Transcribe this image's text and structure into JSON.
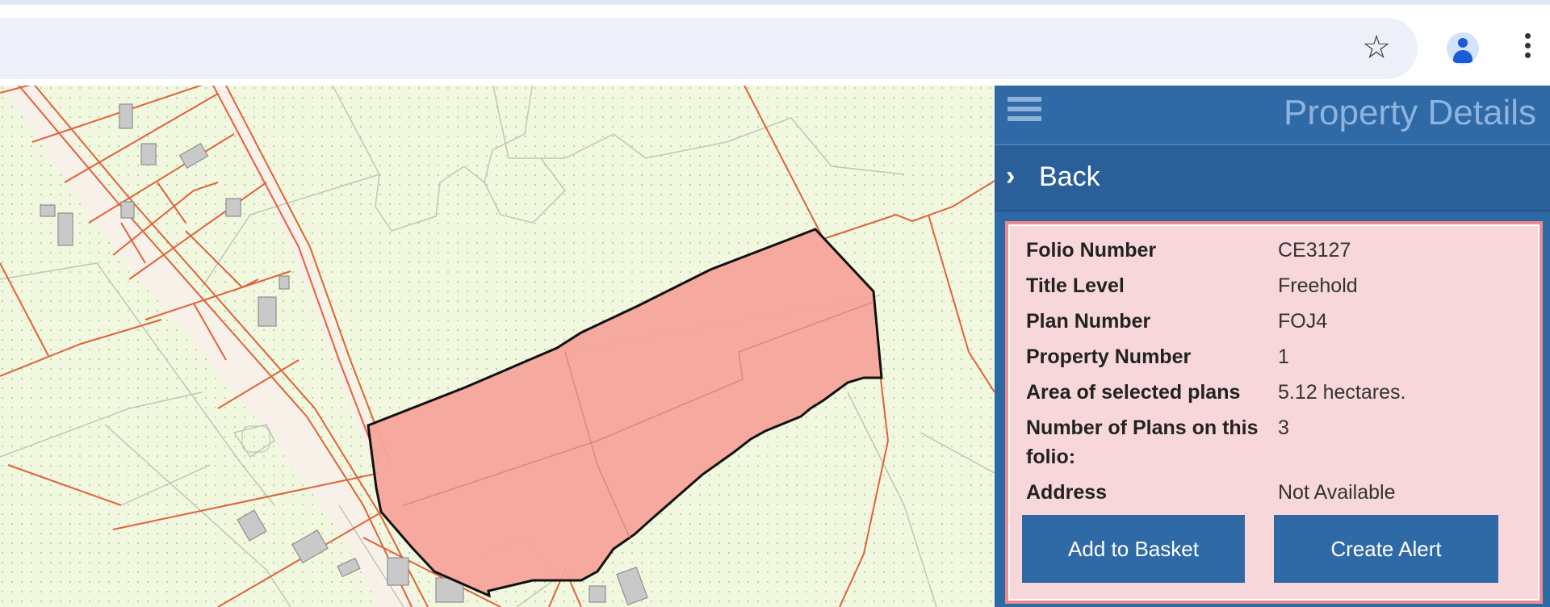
{
  "browser": {
    "bookmark_icon": "star-icon",
    "profile_icon": "account-icon",
    "menu_icon": "kebab-menu-icon"
  },
  "panel": {
    "title": "Property Details",
    "menu_icon": "hamburger-icon",
    "back_label": "Back",
    "back_icon": "chevron-right-icon",
    "details": [
      {
        "label": "Folio Number",
        "value": "CE3127"
      },
      {
        "label": "Title Level",
        "value": "Freehold"
      },
      {
        "label": "Plan Number",
        "value": "FOJ4"
      },
      {
        "label": "Property Number",
        "value": "1"
      },
      {
        "label": "Area of selected plans",
        "value": "5.12 hectares."
      },
      {
        "label": "Number of Plans on this folio:",
        "value": "3"
      },
      {
        "label": "Address",
        "value": "Not Available"
      }
    ],
    "buttons": {
      "add_to_basket": "Add to Basket",
      "create_alert": "Create Alert"
    }
  },
  "colors": {
    "map_background": "#f1f8df",
    "parcel_line": "#e0623c",
    "selected_parcel_fill": "#f5a49a",
    "panel_blue": "#2f6aa7",
    "details_background": "#f7d7d9"
  }
}
